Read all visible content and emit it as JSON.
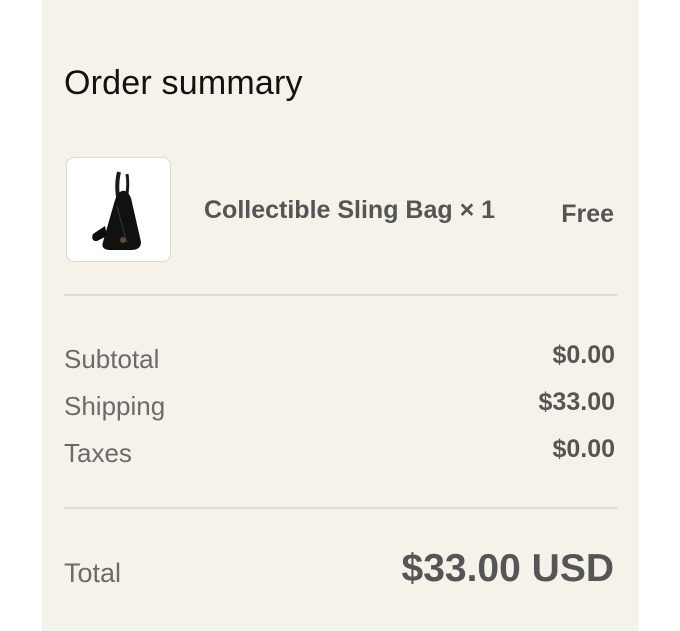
{
  "order_summary": {
    "title": "Order summary",
    "item": {
      "image_icon": "sling-bag-image",
      "name": "Collectible Sling Bag × 1",
      "price": "Free"
    },
    "rows": [
      {
        "label": "Subtotal",
        "value": "$0.00"
      },
      {
        "label": "Shipping",
        "value": "$33.00"
      },
      {
        "label": "Taxes",
        "value": "$0.00"
      }
    ],
    "total": {
      "label": "Total",
      "value": "$33.00 USD"
    }
  },
  "colors": {
    "panel_background": "#f5f2e9",
    "text_dark": "#111111",
    "text_muted": "#6b6b6b",
    "divider": "#dedad1"
  }
}
